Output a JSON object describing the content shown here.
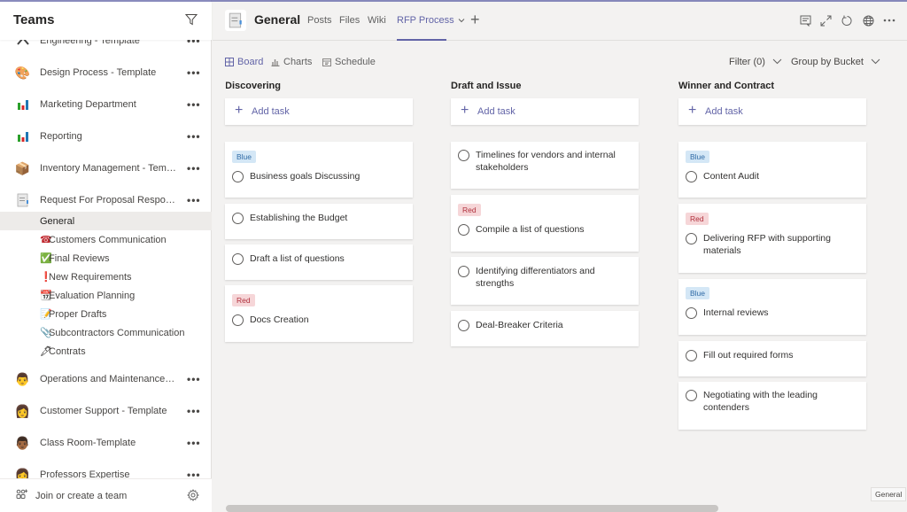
{
  "sidebar": {
    "title": "Teams",
    "teams": [
      {
        "name": "Engineering - Template",
        "icon": "engineering-icon"
      },
      {
        "name": "Design Process - Template",
        "icon": "palette-icon"
      },
      {
        "name": "Marketing Department",
        "icon": "bar-chart-icon"
      },
      {
        "name": "Reporting",
        "icon": "bar-chart-icon"
      },
      {
        "name": "Inventory Management - Temp...",
        "icon": "package-icon"
      },
      {
        "name": "Request For Proposal Response...",
        "icon": "document-icon"
      }
    ],
    "channels": [
      {
        "name": "General",
        "icon": ""
      },
      {
        "name": "Customers Communication",
        "icon": "☎"
      },
      {
        "name": "Final Reviews",
        "icon": "✅"
      },
      {
        "name": "New Requirements",
        "icon": "❗"
      },
      {
        "name": "Evaluation Planning",
        "icon": "📆"
      },
      {
        "name": "Proper Drafts",
        "icon": "📝"
      },
      {
        "name": "Subcontractors Communication",
        "icon": "📎"
      },
      {
        "name": "Contrats",
        "icon": "🖋"
      }
    ],
    "teams_after": [
      {
        "name": "Operations and Maintenance - ...",
        "icon": "👨"
      },
      {
        "name": "Customer Support - Template",
        "icon": "👩"
      },
      {
        "name": "Class Room-Template",
        "icon": "👨🏾"
      },
      {
        "name": "Professors Expertise",
        "icon": "👩"
      }
    ],
    "more": "•••",
    "join_label": "Join or create a team"
  },
  "header": {
    "channel_title": "General",
    "tabs": [
      "Posts",
      "Files",
      "Wiki",
      "RFP Process"
    ],
    "active_tab": "RFP Process",
    "add_tab": "+"
  },
  "toolbar": {
    "views": [
      "Board",
      "Charts",
      "Schedule"
    ],
    "active_view": "Board",
    "filter_label": "Filter (0)",
    "group_label": "Group by Bucket"
  },
  "board": {
    "add_task_label": "Add task",
    "buckets": [
      {
        "title": "Discovering",
        "tasks": [
          {
            "label": "Blue",
            "label_color": "blue",
            "title": "Business goals Discussing"
          },
          {
            "label": "",
            "label_color": "",
            "title": "Establishing the Budget"
          },
          {
            "label": "",
            "label_color": "",
            "title": "Draft a list of questions"
          },
          {
            "label": "Red",
            "label_color": "red",
            "title": "Docs Creation"
          }
        ]
      },
      {
        "title": "Draft and Issue",
        "tasks": [
          {
            "label": "",
            "label_color": "",
            "title": "Timelines for vendors and internal stakeholders"
          },
          {
            "label": "Red",
            "label_color": "red",
            "title": "Compile a list of questions"
          },
          {
            "label": "",
            "label_color": "",
            "title": "Identifying differentiators and strengths"
          },
          {
            "label": "",
            "label_color": "",
            "title": "Deal-Breaker Criteria"
          }
        ]
      },
      {
        "title": "Winner and Contract",
        "tasks": [
          {
            "label": "Blue",
            "label_color": "blue",
            "title": "Content Audit"
          },
          {
            "label": "Red",
            "label_color": "red",
            "title": "Delivering RFP with supporting materials"
          },
          {
            "label": "Blue",
            "label_color": "blue",
            "title": "Internal reviews"
          },
          {
            "label": "",
            "label_color": "",
            "title": "Fill out required forms"
          },
          {
            "label": "",
            "label_color": "",
            "title": "Negotiating with the leading contenders"
          }
        ]
      }
    ]
  },
  "tooltip": "General",
  "colors": {
    "accent": "#6264a7",
    "blue_label_bg": "#d4e7f6",
    "red_label_bg": "#f6d6d8"
  }
}
